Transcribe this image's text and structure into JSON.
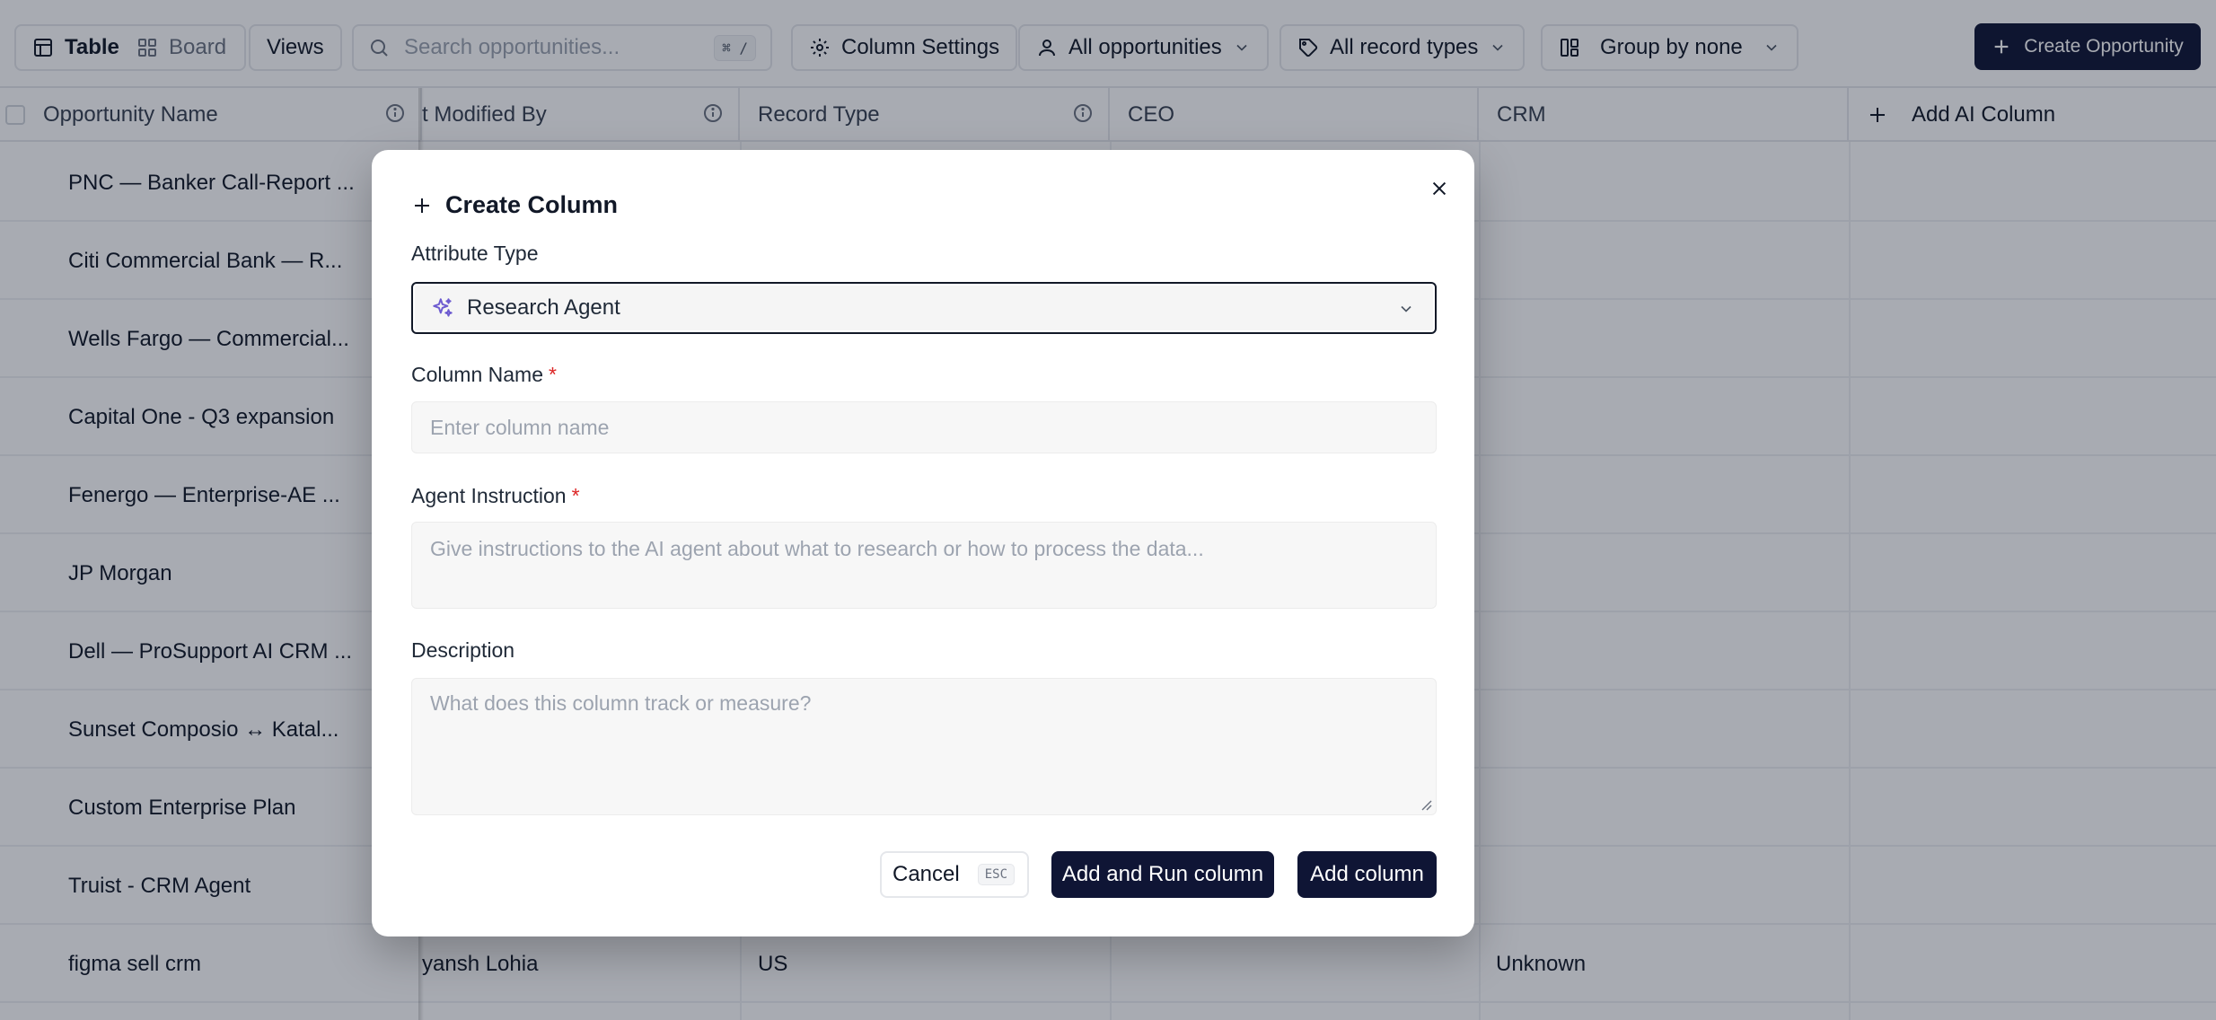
{
  "toolbar": {
    "view_table": "Table",
    "view_board": "Board",
    "views": "Views",
    "search_placeholder": "Search opportunities...",
    "search_shortcut": "⌘ /",
    "column_settings": "Column Settings",
    "owner_filter": "All opportunities",
    "record_type_filter": "All record types",
    "group_by": "Group by none",
    "create_opportunity": "Create Opportunity"
  },
  "table": {
    "columns": [
      "Opportunity Name",
      "t Modified By",
      "Record Type",
      "CEO",
      "CRM",
      "Add AI Column"
    ],
    "rows": [
      {
        "name": "PNC — Banker Call-Report ...",
        "modified_by": "",
        "record_type": "",
        "crm": ""
      },
      {
        "name": "Citi Commercial Bank — R...",
        "modified_by": "",
        "record_type": "",
        "crm": ""
      },
      {
        "name": "Wells Fargo — Commercial...",
        "modified_by": "",
        "record_type": "",
        "crm": ""
      },
      {
        "name": "Capital One - Q3 expansion",
        "modified_by": "",
        "record_type": "",
        "crm": ""
      },
      {
        "name": "Fenergo — Enterprise-AE ...",
        "modified_by": "",
        "record_type": "",
        "crm": ""
      },
      {
        "name": "JP Morgan",
        "modified_by": "",
        "record_type": "",
        "crm": ""
      },
      {
        "name": "Dell — ProSupport AI CRM ...",
        "modified_by": "",
        "record_type": "",
        "crm": ""
      },
      {
        "name": "Sunset Composio ↔ Katal...",
        "modified_by": "",
        "record_type": "",
        "crm": ""
      },
      {
        "name": "Custom Enterprise Plan",
        "modified_by": "",
        "record_type": "",
        "crm": ""
      },
      {
        "name": "Truist - CRM Agent",
        "modified_by": "",
        "record_type": "",
        "crm": ""
      },
      {
        "name": "figma sell crm",
        "modified_by": "yansh Lohia",
        "record_type": "US",
        "crm": "Unknown"
      }
    ]
  },
  "modal": {
    "title": "Create Column",
    "attribute_type_label": "Attribute Type",
    "attribute_type_value": "Research Agent",
    "column_name_label": "Column Name",
    "required_mark": "*",
    "column_name_placeholder": "Enter column name",
    "agent_instruction_label": "Agent Instruction",
    "agent_instruction_placeholder": "Give instructions to the AI agent about what to research or how to process the data...",
    "description_label": "Description",
    "description_placeholder": "What does this column track or measure?",
    "cancel": "Cancel",
    "cancel_shortcut": "ESC",
    "add_and_run": "Add and Run column",
    "add": "Add column"
  },
  "colors": {
    "primary": "#0f1535",
    "required": "#dc2626",
    "agent_icon": "#6d5bd0"
  }
}
